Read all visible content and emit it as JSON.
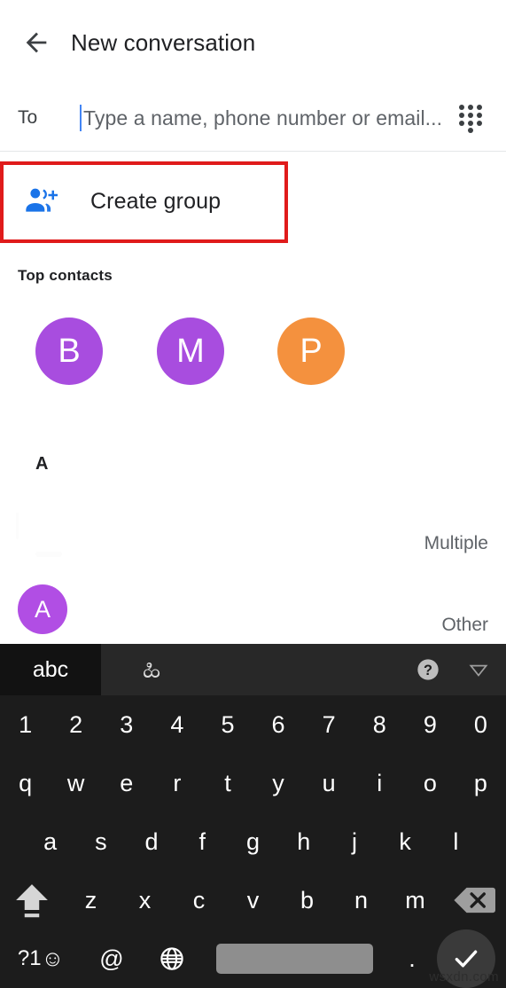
{
  "header": {
    "back_icon": "arrow-left-icon",
    "title": "New conversation"
  },
  "to_field": {
    "label": "To",
    "value": "",
    "placeholder": "Type a name, phone number or email...",
    "dialpad_icon": "dialpad-icon"
  },
  "create_group": {
    "icon": "person-add-icon",
    "label": "Create group",
    "icon_color": "#1a73e8",
    "highlight_color": "#e01b1b"
  },
  "top_contacts": {
    "label": "Top contacts",
    "avatars": [
      {
        "initial": "B",
        "color": "#a84ddf"
      },
      {
        "initial": "M",
        "color": "#a84ddf"
      },
      {
        "initial": "P",
        "color": "#f4913e"
      }
    ]
  },
  "contacts_section": {
    "alpha_header": "A",
    "rows": [
      {
        "type_label": "Multiple"
      },
      {
        "type_label": "Other",
        "avatar_initial": "A",
        "avatar_color": "#b14ee4"
      }
    ]
  },
  "keyboard": {
    "toolbar": {
      "abc_label": "abc",
      "script_label": "ಹಿ",
      "help_icon": "help-circle-icon",
      "collapse_icon": "chevron-down-triangle-icon"
    },
    "rows": {
      "numbers": [
        "1",
        "2",
        "3",
        "4",
        "5",
        "6",
        "7",
        "8",
        "9",
        "0"
      ],
      "qwerty": [
        "q",
        "w",
        "e",
        "r",
        "t",
        "y",
        "u",
        "i",
        "o",
        "p"
      ],
      "asdf": [
        "a",
        "s",
        "d",
        "f",
        "g",
        "h",
        "j",
        "k",
        "l"
      ],
      "zxcv": [
        "z",
        "x",
        "c",
        "v",
        "b",
        "n",
        "m"
      ]
    },
    "shift_icon": "shift-arrow-icon",
    "delete_icon": "backspace-icon",
    "bottom": {
      "symbols_label": "?1",
      "emoji_icon": "smiley-icon",
      "at_label": "@",
      "globe_icon": "globe-icon",
      "space_label": "",
      "period_label": ".",
      "enter_icon": "check-icon"
    }
  },
  "watermark": "wsxdn.com"
}
